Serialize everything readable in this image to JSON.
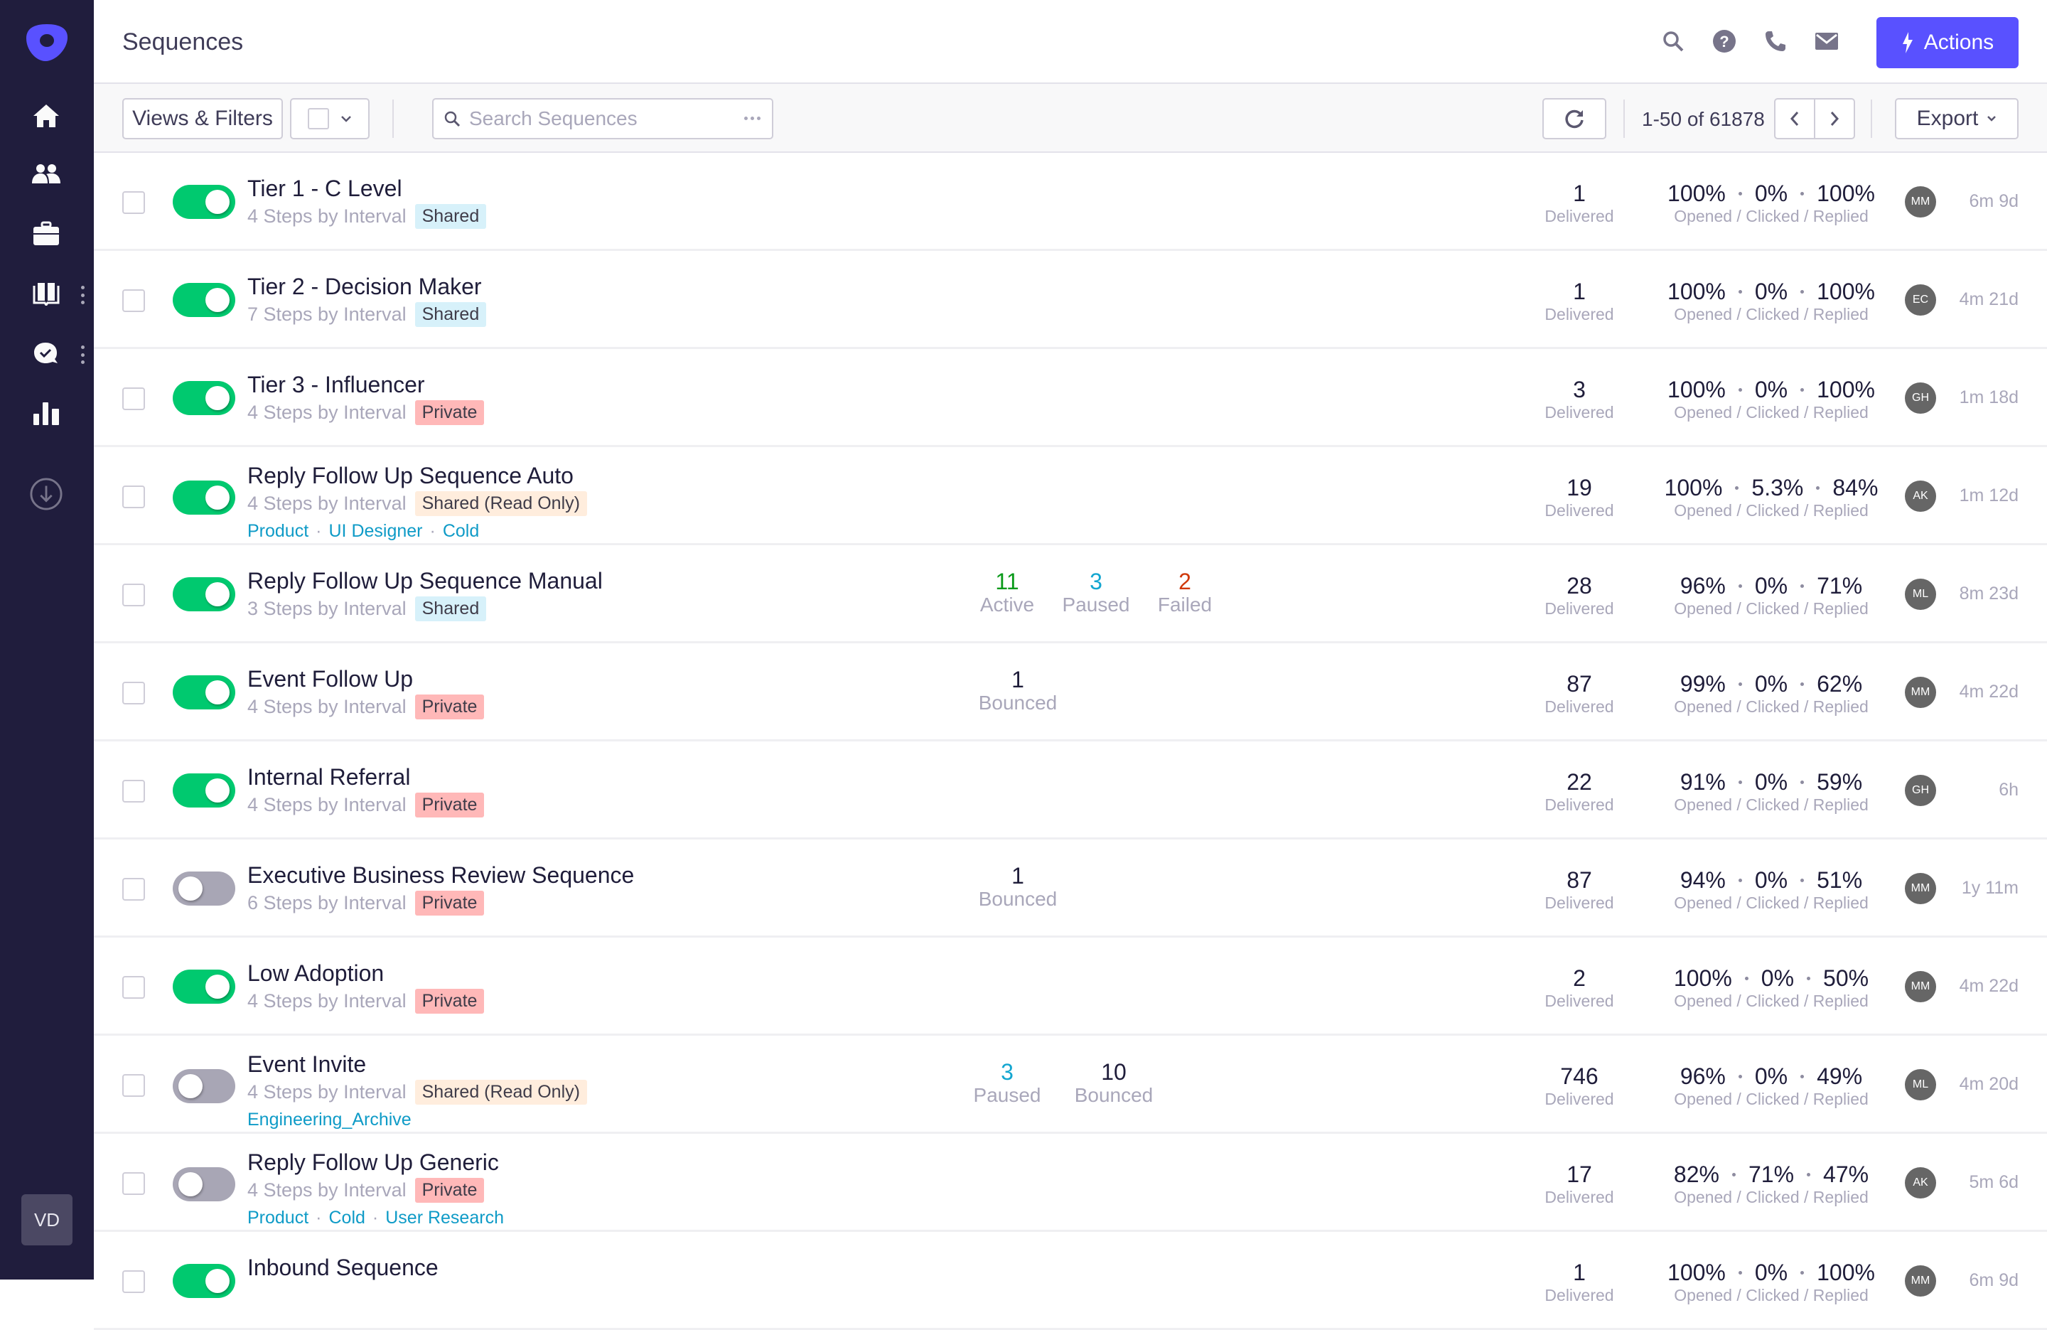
{
  "app": {
    "brand_color": "#5951ff",
    "sidebar_bg": "#201d3d"
  },
  "sidebar": {
    "items": [
      {
        "name": "home",
        "icon": "home-icon"
      },
      {
        "name": "prospects",
        "icon": "people-icon"
      },
      {
        "name": "accounts",
        "icon": "briefcase-icon"
      },
      {
        "name": "library",
        "icon": "book-icon",
        "has_menu": true
      },
      {
        "name": "tasks",
        "icon": "chat-check-icon",
        "has_menu": true
      },
      {
        "name": "reports",
        "icon": "bar-chart-icon"
      },
      {
        "name": "download",
        "icon": "download-icon"
      }
    ],
    "user_initials": "VD"
  },
  "header": {
    "title": "Sequences",
    "icons": [
      "search-icon",
      "help-icon",
      "phone-icon",
      "mail-icon"
    ],
    "actions_label": "Actions"
  },
  "toolbar": {
    "views_filters_label": "Views & Filters",
    "search_placeholder": "Search Sequences",
    "search_value": "",
    "pager_text": "1-50 of 61878",
    "export_label": "Export"
  },
  "labels": {
    "delivered": "Delivered",
    "rates": "Opened / Clicked / Replied"
  },
  "rows": [
    {
      "name": "Tier 1 - C Level",
      "steps": "4 Steps by Interval",
      "visibility": "Shared",
      "vis_type": "shared",
      "tags": [],
      "enabled": true,
      "mid": [],
      "delivered": "1",
      "opened": "100%",
      "clicked": "0%",
      "replied": "100%",
      "owner": "MM",
      "age": "6m 9d"
    },
    {
      "name": "Tier 2 - Decision Maker",
      "steps": "7 Steps by Interval",
      "visibility": "Shared",
      "vis_type": "shared",
      "tags": [],
      "enabled": true,
      "mid": [],
      "delivered": "1",
      "opened": "100%",
      "clicked": "0%",
      "replied": "100%",
      "owner": "EC",
      "age": "4m 21d"
    },
    {
      "name": "Tier 3 - Influencer",
      "steps": "4 Steps by Interval",
      "visibility": "Private",
      "vis_type": "private",
      "tags": [],
      "enabled": true,
      "mid": [],
      "delivered": "3",
      "opened": "100%",
      "clicked": "0%",
      "replied": "100%",
      "owner": "GH",
      "age": "1m 18d"
    },
    {
      "name": "Reply Follow Up Sequence Auto",
      "steps": "4 Steps by Interval",
      "visibility": "Shared (Read Only)",
      "vis_type": "readonly",
      "tags": [
        "Product",
        "UI Designer",
        "Cold"
      ],
      "enabled": true,
      "mid": [],
      "delivered": "19",
      "opened": "100%",
      "clicked": "5.3%",
      "replied": "84%",
      "owner": "AK",
      "age": "1m 12d"
    },
    {
      "name": "Reply Follow Up Sequence Manual",
      "steps": "3 Steps by Interval",
      "visibility": "Shared",
      "vis_type": "shared",
      "tags": [],
      "enabled": true,
      "mid": [
        {
          "value": "11",
          "label": "Active",
          "color": "#0a9a1a"
        },
        {
          "value": "3",
          "label": "Paused",
          "color": "#13a6d0"
        },
        {
          "value": "2",
          "label": "Failed",
          "color": "#d03a0c"
        }
      ],
      "delivered": "28",
      "opened": "96%",
      "clicked": "0%",
      "replied": "71%",
      "owner": "ML",
      "age": "8m 23d"
    },
    {
      "name": "Event Follow Up",
      "steps": "4 Steps by Interval",
      "visibility": "Private",
      "vis_type": "private",
      "tags": [],
      "enabled": true,
      "mid": [
        {
          "value": "1",
          "label": "Bounced",
          "color": "#1f1d3a"
        }
      ],
      "delivered": "87",
      "opened": "99%",
      "clicked": "0%",
      "replied": "62%",
      "owner": "MM",
      "age": "4m 22d"
    },
    {
      "name": "Internal Referral",
      "steps": "4 Steps by Interval",
      "visibility": "Private",
      "vis_type": "private",
      "tags": [],
      "enabled": true,
      "mid": [],
      "delivered": "22",
      "opened": "91%",
      "clicked": "0%",
      "replied": "59%",
      "owner": "GH",
      "age": "6h"
    },
    {
      "name": "Executive Business Review Sequence",
      "steps": "6 Steps by Interval",
      "visibility": "Private",
      "vis_type": "private",
      "tags": [],
      "enabled": false,
      "mid": [
        {
          "value": "1",
          "label": "Bounced",
          "color": "#1f1d3a"
        }
      ],
      "delivered": "87",
      "opened": "94%",
      "clicked": "0%",
      "replied": "51%",
      "owner": "MM",
      "age": "1y 11m"
    },
    {
      "name": "Low Adoption",
      "steps": "4 Steps by Interval",
      "visibility": "Private",
      "vis_type": "private",
      "tags": [],
      "enabled": true,
      "mid": [],
      "delivered": "2",
      "opened": "100%",
      "clicked": "0%",
      "replied": "50%",
      "owner": "MM",
      "age": "4m 22d"
    },
    {
      "name": "Event Invite",
      "steps": "4 Steps by Interval",
      "visibility": "Shared (Read Only)",
      "vis_type": "readonly",
      "tags": [
        "Engineering_Archive"
      ],
      "enabled": false,
      "mid": [
        {
          "value": "3",
          "label": "Paused",
          "color": "#13a6d0"
        },
        {
          "value": "10",
          "label": "Bounced",
          "color": "#1f1d3a"
        }
      ],
      "delivered": "746",
      "opened": "96%",
      "clicked": "0%",
      "replied": "49%",
      "owner": "ML",
      "age": "4m 20d"
    },
    {
      "name": "Reply Follow Up Generic",
      "steps": "4 Steps by Interval",
      "visibility": "Private",
      "vis_type": "private",
      "tags": [
        "Product",
        "Cold",
        "User Research"
      ],
      "enabled": false,
      "mid": [],
      "delivered": "17",
      "opened": "82%",
      "clicked": "71%",
      "replied": "47%",
      "owner": "AK",
      "age": "5m 6d"
    },
    {
      "name": "Inbound Sequence",
      "steps": "",
      "visibility": "",
      "vis_type": "",
      "tags": [],
      "enabled": true,
      "mid": [],
      "delivered": "1",
      "opened": "100%",
      "clicked": "0%",
      "replied": "100%",
      "owner": "MM",
      "age": "6m 9d"
    }
  ]
}
